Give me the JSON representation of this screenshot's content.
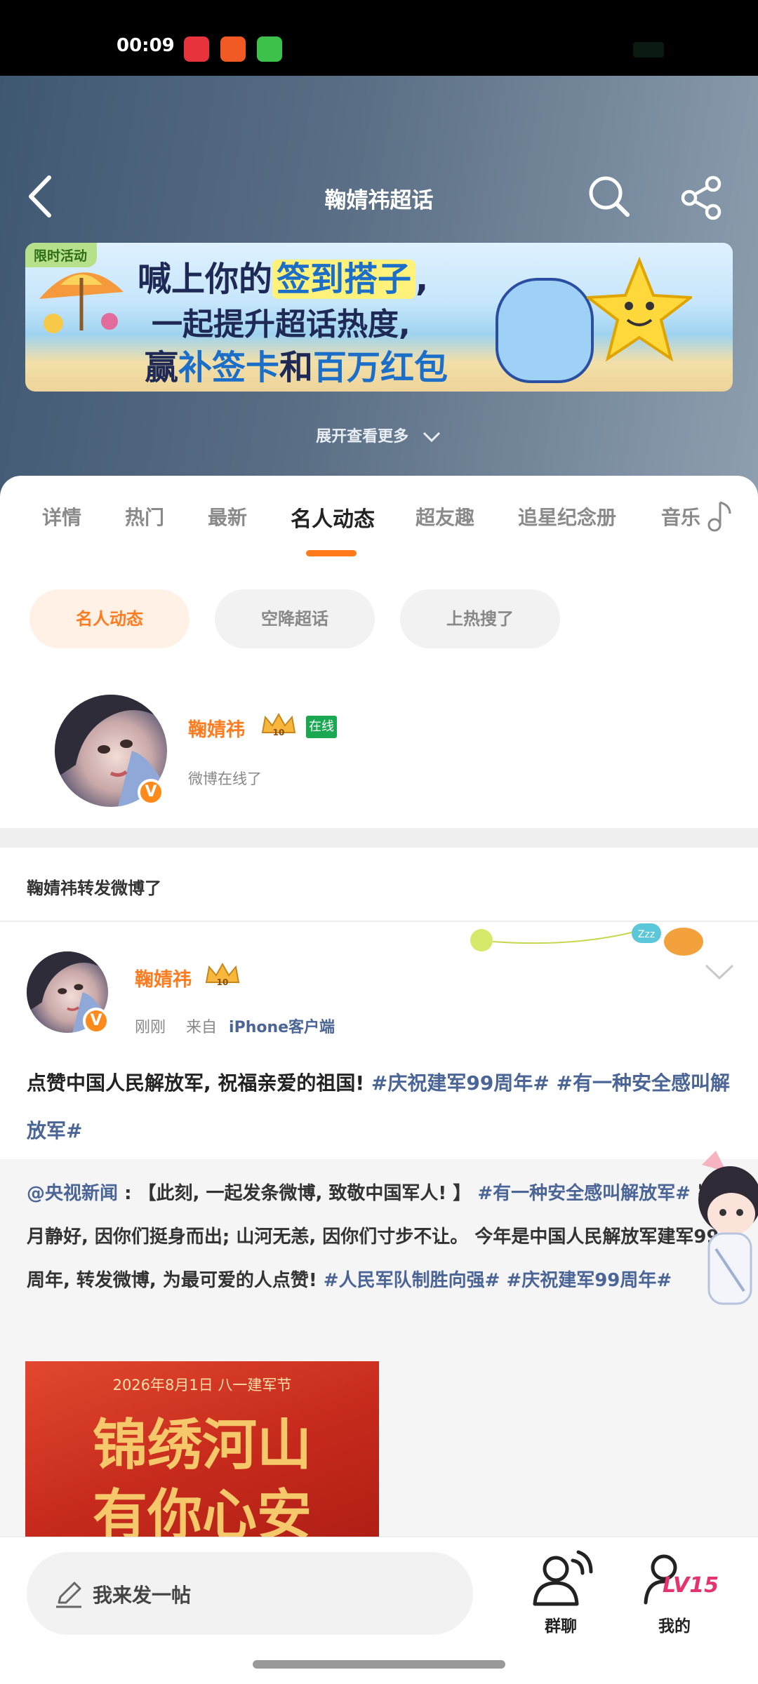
{
  "status_bar": {
    "time": "00:09"
  },
  "header": {
    "title": "鞠婧祎超话",
    "expand_label": "展开查看更多"
  },
  "banner": {
    "badge": "限时活动",
    "line1_a": "喊上你的",
    "line1_hl": "签到搭子",
    "line1_b": ",",
    "line2": "一起提升超话热度,",
    "line3_a": "赢",
    "line3_b": "补签卡",
    "line3_c": "和",
    "line3_d": "百万红包"
  },
  "tabs": [
    {
      "label": "详情"
    },
    {
      "label": "热门"
    },
    {
      "label": "最新"
    },
    {
      "label": "名人动态",
      "active": true
    },
    {
      "label": "超友趣"
    },
    {
      "label": "追星纪念册"
    },
    {
      "label": "音乐"
    }
  ],
  "chips": [
    {
      "label": "名人动态",
      "active": true
    },
    {
      "label": "空降超话"
    },
    {
      "label": "上热搜了"
    }
  ],
  "star_card": {
    "name": "鞠婧祎",
    "level": "10",
    "status_badge": "在线",
    "subtitle": "微博在线了"
  },
  "repost_label": "鞠婧祎转发微博了",
  "post": {
    "author": "鞠婧祎",
    "time": "刚刚",
    "from_label": "来自",
    "source": "iPhone客户端",
    "text_plain": "点赞中国人民解放军, 祝福亲爱的祖国!",
    "tag1": "#庆祝建军99周年#",
    "tag2": "#有一种安全感叫解放军#"
  },
  "repost": {
    "mention": "@央视新闻",
    "text_a": ": 【此刻, 一起发条微博, 致敬中国军人! 】",
    "tag1": "#有一种安全感叫解放军#",
    "text_b": "岁月静好, 因你们挺身而出; 山河无恙, 因你们寸步不让。 今年是中国人民解放军建军99周年, 转发微博, 为最可爱的人点赞!",
    "tag2": "#人民军队制胜向强#",
    "tag3": "#庆祝建军99周年#",
    "poster_date": "2026年8月1日  八一建军节",
    "poster_line1": "锦绣河山",
    "poster_line2": "有你心安"
  },
  "bottom": {
    "compose_label": "我来发一帖",
    "group_chat": "群聊",
    "mine": "我的",
    "level": "LV15"
  },
  "colors": {
    "accent": "#ff7b1f",
    "link": "#4a6596",
    "online": "#1aa852",
    "level": "#e5336f"
  }
}
